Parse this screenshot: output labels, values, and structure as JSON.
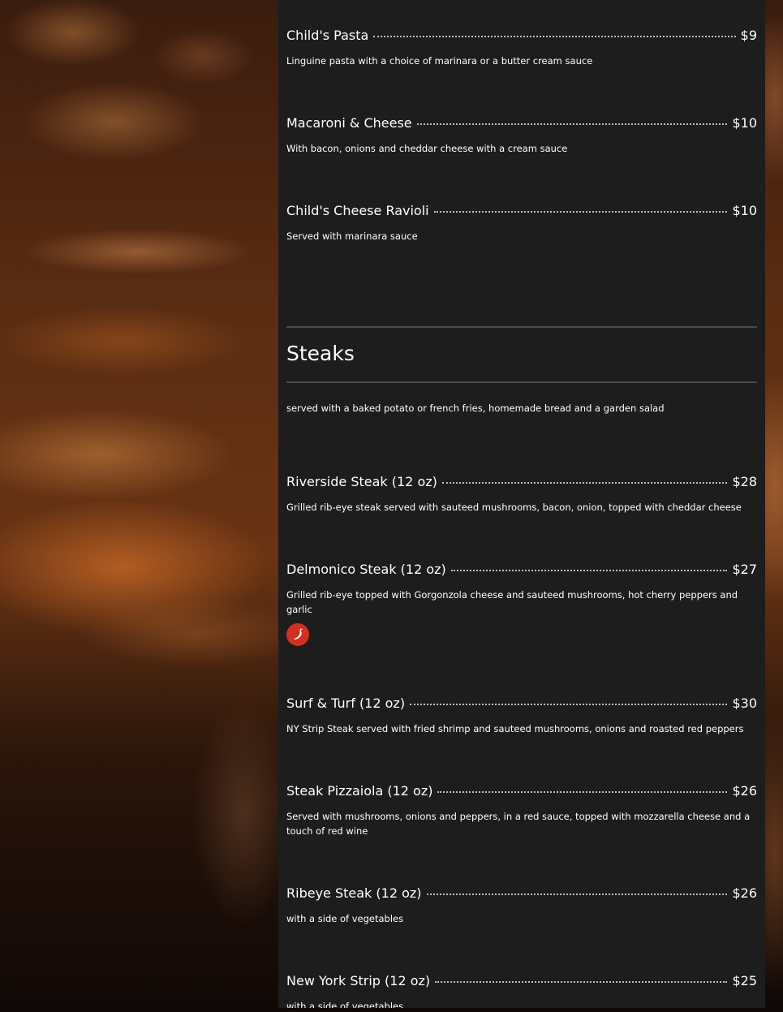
{
  "menu": {
    "kids_items": [
      {
        "name": "Child's Pasta",
        "price": "$9",
        "description": "Linguine pasta with a choice of marinara or a butter cream sauce"
      },
      {
        "name": "Macaroni & Cheese",
        "price": "$10",
        "description": "With bacon, onions and cheddar cheese with a cream sauce"
      },
      {
        "name": "Child's Cheese Ravioli",
        "price": "$10",
        "description": "Served with marinara sauce"
      }
    ],
    "steaks": {
      "title": "Steaks",
      "note": "served with a baked potato or french fries, homemade bread and a garden salad",
      "items": [
        {
          "name": "Riverside Steak (12 oz)",
          "price": "$28",
          "description": "Grilled rib-eye steak served with sauteed mushrooms, bacon, onion, topped with cheddar cheese"
        },
        {
          "name": "Delmonico Steak (12 oz)",
          "price": "$27",
          "description": "Grilled rib-eye topped with Gorgonzola cheese and sauteed mushrooms, hot cherry peppers and garlic",
          "badge_icon": "chili-pepper-icon"
        },
        {
          "name": "Surf & Turf (12 oz)",
          "price": "$30",
          "description": "NY Strip Steak served with fried shrimp and sauteed mushrooms, onions and roasted red peppers"
        },
        {
          "name": "Steak Pizzaiola (12 oz)",
          "price": "$26",
          "description": "Served with mushrooms, onions and peppers, in a red sauce, topped with mozzarella cheese and a touch of red wine"
        },
        {
          "name": "Ribeye Steak (12 oz)",
          "price": "$26",
          "description": "with a side of vegetables"
        },
        {
          "name": "New York Strip (12 oz)",
          "price": "$25",
          "description": "with a side of vegetables"
        }
      ]
    }
  },
  "colors": {
    "panel": "#1d1d1d",
    "text": "#ffffff",
    "rule": "#4a4a4a",
    "spicy_badge": "#d4301f"
  }
}
